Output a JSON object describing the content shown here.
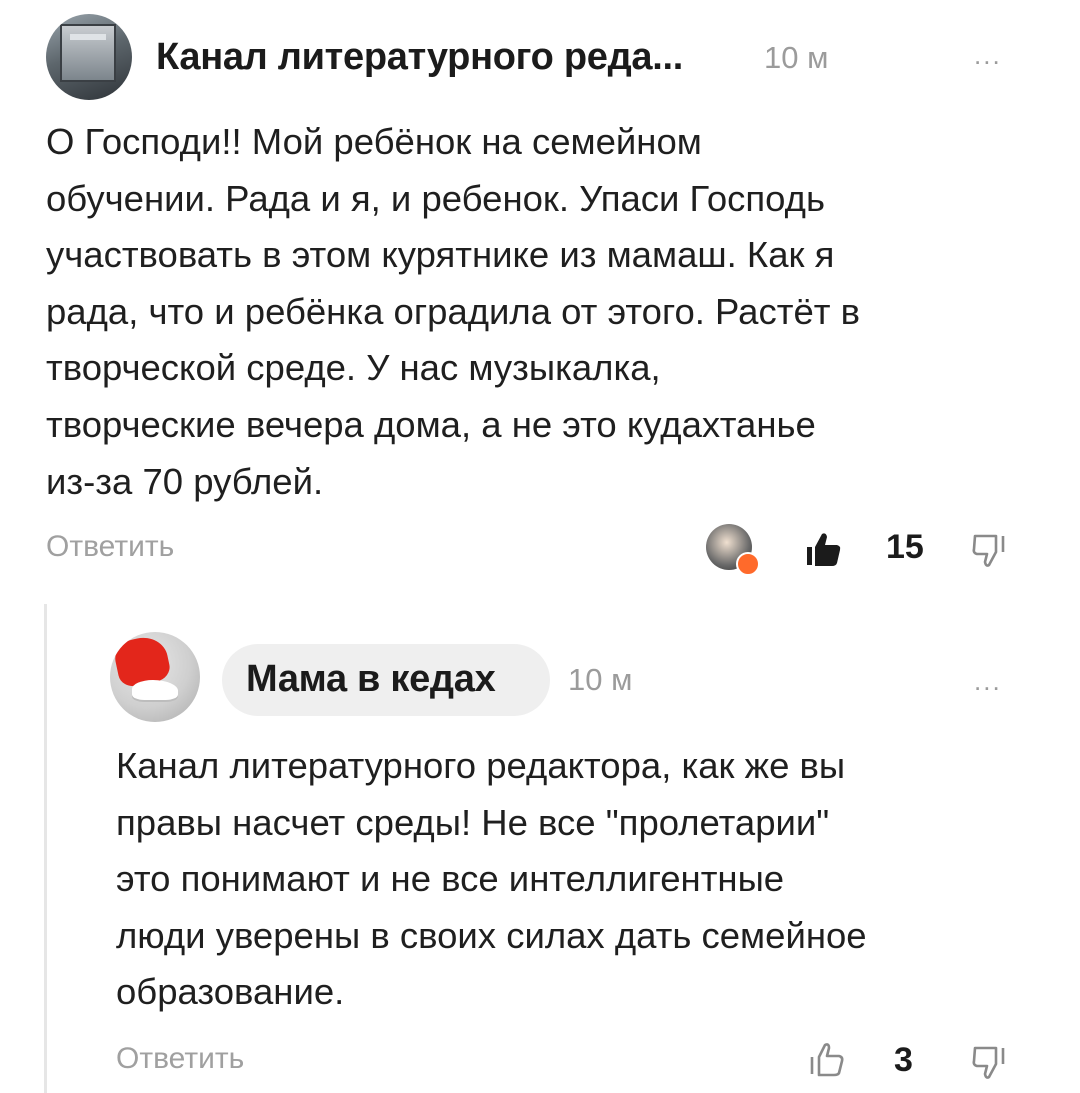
{
  "comments": [
    {
      "author": "Канал литературного реда...",
      "time": "10 м",
      "more": "...",
      "text": "О Господи!! Мой ребёнок на семейном\nобучении. Рада и я, и ребенок. Упаси Господь\nучаствовать в этом курятнике из мамаш. Как я\nрада, что и ребёнка оградила от этого. Растёт в\nтворческой среде. У нас музыкалка,\nтворческие вечера дома, а не это кудахтанье\nиз-за 70 рублей.",
      "reply_label": "Ответить",
      "likes": "15",
      "liked": true
    },
    {
      "author": "Мама в кедах",
      "time": "10 м",
      "more": "...",
      "text": "Канал литературного редактора, как же вы\nправы насчет среды! Не все \"пролетарии\"\nэто понимают и не все интеллигентные\nлюди уверены в своих силах дать семейное\nобразование.",
      "reply_label": "Ответить",
      "likes": "3",
      "liked": false
    }
  ],
  "icons": {
    "like_filled": "thumbs-up-filled-icon",
    "like_outline": "thumbs-up-outline-icon",
    "dislike": "thumbs-down-outline-icon",
    "more": "more-dots-icon"
  },
  "colors": {
    "text": "#1f1f1f",
    "muted": "#9b9b9b",
    "pill": "#efefef",
    "liker_heart": "#ff6a2b"
  }
}
